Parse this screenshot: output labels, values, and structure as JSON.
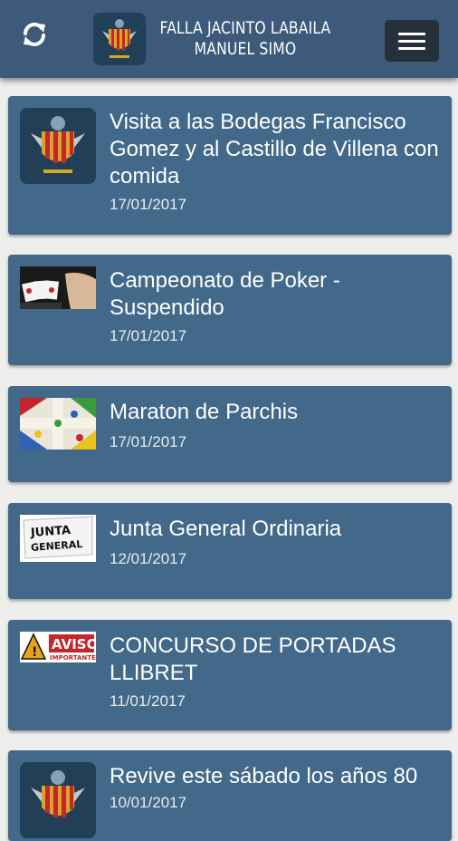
{
  "header": {
    "title_line1": "FALLA JACINTO LABAILA",
    "title_line2": "MANUEL SIMO",
    "refresh_icon": "refresh-icon",
    "menu_icon": "hamburger-menu-icon"
  },
  "colors": {
    "header_bg": "#3d5a7a",
    "card_bg": "#42688a",
    "menu_button_bg": "#25303b",
    "page_bg": "#eeeeec"
  },
  "news": [
    {
      "title": "Visita a las Bodegas Francisco Gomez y al Castillo de Villena con comida",
      "date": "17/01/2017",
      "thumbnail": "falla-crest"
    },
    {
      "title": "Campeonato de Poker - Suspendido",
      "date": "17/01/2017",
      "thumbnail": "poker"
    },
    {
      "title": "Maraton de Parchis",
      "date": "17/01/2017",
      "thumbnail": "parchis-board"
    },
    {
      "title": "Junta General Ordinaria",
      "date": "12/01/2017",
      "thumbnail": "junta-general",
      "thumbnail_text": "JUNTA GENERAL"
    },
    {
      "title": "CONCURSO DE PORTADAS LLIBRET",
      "date": "11/01/2017",
      "thumbnail": "aviso-warning",
      "thumbnail_text": "AVISO IMPORTANTE"
    },
    {
      "title": "Revive este sábado los años 80",
      "date": "10/01/2017",
      "thumbnail": "falla-crest"
    }
  ]
}
